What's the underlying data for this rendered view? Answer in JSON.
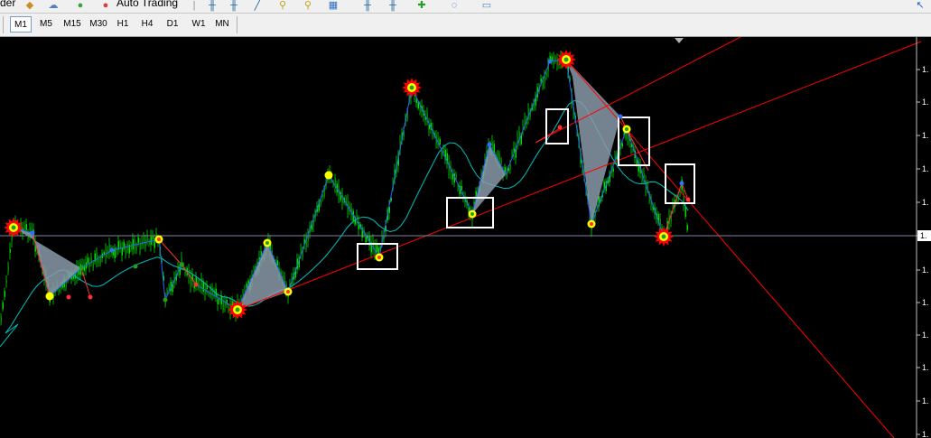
{
  "toolbar": {
    "partial_label": "der",
    "auto_trading_label": "Auto Trading"
  },
  "timeframes": [
    "M1",
    "M5",
    "M15",
    "M30",
    "H1",
    "H4",
    "D1",
    "W1",
    "MN"
  ],
  "active_timeframe": "M1",
  "price_axis_labels": [
    "1.",
    "1.",
    "1.",
    "1.",
    "1.",
    "1.",
    "1.",
    "1.",
    "1.",
    "1.",
    "1.",
    "1."
  ],
  "current_price_label": "1.",
  "colors": {
    "background": "#000000",
    "candle": "#00c800",
    "trend_line": "#ff0000",
    "moving_average": "#00c8c8",
    "zigzag": "#3070ff",
    "pattern_fill": "#8090a0",
    "pivot_marker": "#ffff00",
    "burst_marker": "#ff0000",
    "highlight_box": "#ffffff"
  },
  "icons": [
    "package-icon",
    "cloud-icon",
    "globe-icon",
    "auto-trading-icon",
    "chart-bars-icon",
    "chart-candles-icon",
    "chart-line-icon",
    "zoom-in-icon",
    "zoom-out-icon",
    "tile-windows-icon",
    "chart-shift-icon",
    "autoscroll-icon",
    "add-indicator-icon",
    "periods-icon",
    "templates-icon"
  ]
}
